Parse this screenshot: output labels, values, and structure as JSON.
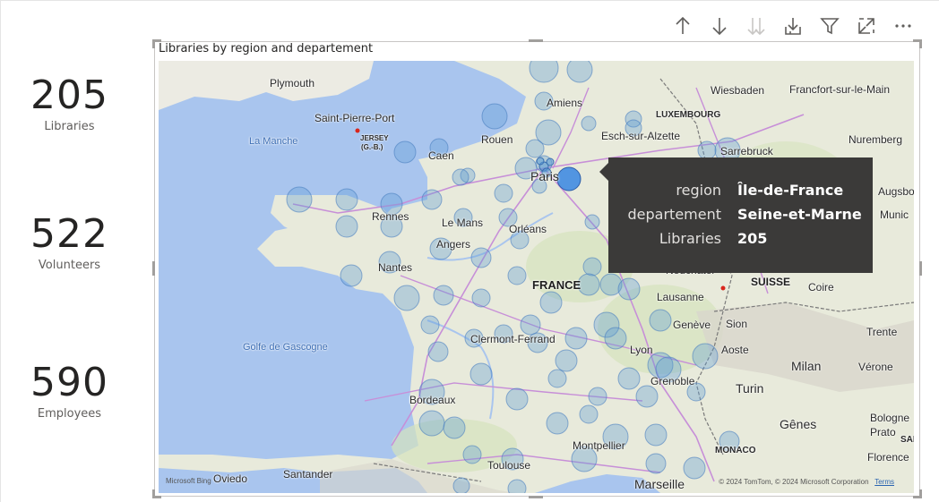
{
  "kpis": [
    {
      "value": "205",
      "label": "Libraries"
    },
    {
      "value": "522",
      "label": "Volunteers"
    },
    {
      "value": "590",
      "label": "Employees"
    }
  ],
  "toolbar": {
    "icons": [
      "arrow-up-icon",
      "arrow-down-icon",
      "double-arrow-down-icon",
      "expand-down-icon",
      "filter-icon",
      "focus-mode-icon",
      "more-options-icon"
    ]
  },
  "visual": {
    "title": "Libraries by region and departement",
    "map_labels": {
      "plymouth": "Plymouth",
      "saint_pierre_port": "Saint-Pierre-Port",
      "jersey": "JERSEY",
      "jersey_sub": "(G.-B.)",
      "la_manche": "La Manche",
      "caen": "Caen",
      "rouen": "Rouen",
      "amiens": "Amiens",
      "paris": "Paris",
      "rennes": "Rennes",
      "le_mans": "Le Mans",
      "orleans": "Orléans",
      "angers": "Angers",
      "nantes": "Nantes",
      "france": "FRANCE",
      "golfe": "Golfe de Gascogne",
      "clermont": "Clermont-Ferrand",
      "lyon": "Lyon",
      "bordeaux": "Bordeaux",
      "grenoble": "Grenoble",
      "montpellier": "Montpellier",
      "toulouse": "Toulouse",
      "marseille": "Marseille",
      "santander": "Santander",
      "oviedo": "Oviedo",
      "luxembourg": "LUXEMBOURG",
      "esch": "Esch-sur-Alzette",
      "wiesbaden": "Wiesbaden",
      "frankfurt": "Francfort-sur-le-Main",
      "nuremberg": "Nuremberg",
      "sarrebruck": "Sarrebruck",
      "augsbourg": "Augsbo",
      "munich": "Munic",
      "neuchatel": "Neuchâtel",
      "lausanne": "Lausanne",
      "suisse": "SUISSE",
      "coire": "Coire",
      "geneve": "Genève",
      "sion": "Sion",
      "aoste": "Aoste",
      "milan": "Milan",
      "verone": "Vérone",
      "trente": "Trente",
      "turin": "Turin",
      "genes": "Gênes",
      "bologne": "Bologne",
      "prato": "Prato",
      "florence": "Florence",
      "monaco": "MONACO",
      "sai": "SAI"
    },
    "bing": "Microsoft Bing",
    "copyright": "© 2024 TomTom, © 2024 Microsoft Corporation",
    "terms": "Terms",
    "bubble_color": "#5b9bd5",
    "selected_color": "#4a90e2"
  },
  "tooltip": {
    "rows": [
      {
        "key": "region",
        "value": "Île-de-France"
      },
      {
        "key": "departement",
        "value": "Seine-et-Marne"
      },
      {
        "key": "Libraries",
        "value": "205"
      }
    ]
  }
}
